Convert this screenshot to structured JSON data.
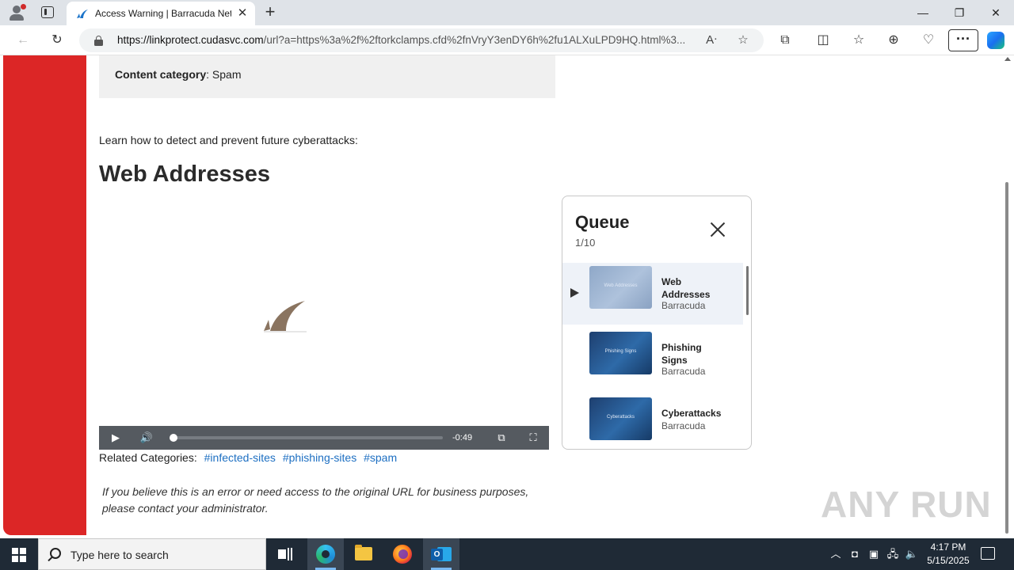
{
  "browser": {
    "tab_title": "Access Warning | Barracuda Netw",
    "url_host": "https://linkprotect.cudasvc.com",
    "url_rest": "/url?a=https%3a%2f%2ftorkclamps.cfd%2fnVryY3enDY6h%2fu1ALXuLPD9HQ.html%3...",
    "icons": [
      "profile-icon",
      "tab-actions-icon",
      "back-icon",
      "refresh-icon",
      "lock-icon",
      "read-aloud-icon",
      "favorite-star-icon",
      "extensions-icon",
      "split-screen-icon",
      "favorites-icon",
      "collections-icon",
      "performance-icon",
      "more-icon",
      "copilot-icon"
    ]
  },
  "page": {
    "info_label": "Content category",
    "info_value": ": Spam",
    "learn_text": "Learn how to detect and prevent future cyberattacks:",
    "heading": "Web Addresses",
    "video": {
      "time_remaining": "-0:49",
      "progress": 0.0
    },
    "related_label": "Related Categories:",
    "related_tags": [
      "#infected-sites",
      "#phishing-sites",
      "#spam"
    ],
    "notice": "If you believe this is an error or need access to the original URL for business purposes, please contact your administrator."
  },
  "queue": {
    "title": "Queue",
    "count": "1/10",
    "items": [
      {
        "name": "Web Addresses",
        "channel": "Barracuda",
        "thumb_title": "Web Addresses",
        "active": true
      },
      {
        "name": "Phishing Signs",
        "channel": "Barracuda",
        "thumb_title": "Phishing Signs",
        "active": false
      },
      {
        "name": "Cyberattacks",
        "channel": "Barracuda",
        "thumb_title": "Cyberattacks",
        "active": false
      }
    ]
  },
  "watermark": "ANY RUN",
  "taskbar": {
    "search_placeholder": "Type here to search",
    "time": "4:17 PM",
    "date": "5/15/2025"
  },
  "colors": {
    "brand_red": "#dc2626",
    "link_blue": "#1d6fc2",
    "taskbar": "#1f2a36"
  }
}
